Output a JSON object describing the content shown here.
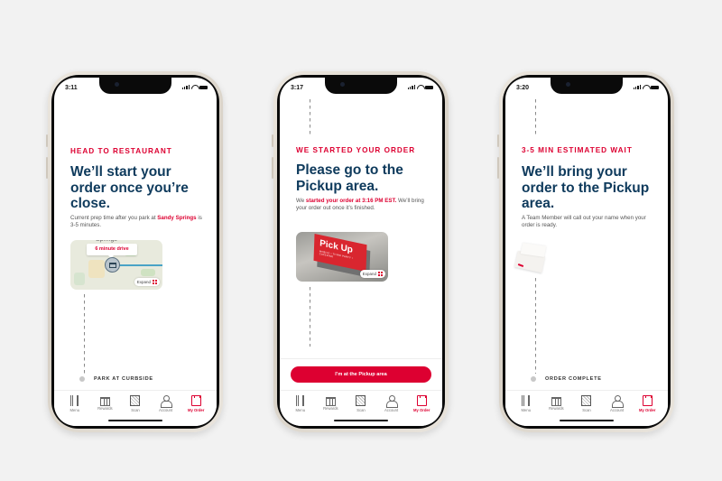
{
  "brand_colors": {
    "accent": "#dd0031",
    "headline": "#0e3a5c",
    "background": "#f2f2f2"
  },
  "tabbar": [
    {
      "label": "Menu",
      "icon": "fork-knife-icon"
    },
    {
      "label": "Rewards",
      "icon": "gift-icon"
    },
    {
      "label": "Scan",
      "icon": "qr-code-icon"
    },
    {
      "label": "Account",
      "icon": "person-icon"
    },
    {
      "label": "My Order",
      "icon": "bag-icon",
      "active": true
    }
  ],
  "phones": [
    {
      "status_time": "3:11",
      "eyebrow": "HEAD TO RESTAURANT",
      "headline": "We’ll start your order once you’re close.",
      "body_prefix": "Current prep time after you park at ",
      "body_highlight": "Sandy Springs",
      "body_suffix": " is 3-5 minutes.",
      "map": {
        "city_label": "Springs",
        "drive_time": "6 minute drive",
        "expand_label": "Expand"
      },
      "next_step": "PARK AT CURBSIDE"
    },
    {
      "status_time": "3:17",
      "eyebrow": "WE STARTED YOUR ORDER",
      "headline": "Please go to the Pickup area.",
      "body_prefix": "We ",
      "body_highlight": "started your order at 3:16 PM EST.",
      "body_suffix": " We’ll bring your order out once it’s finished.",
      "photo": {
        "sign_title": "Pick Up",
        "sign_subtitle": "MOBILE • THIRD PARTY • CATERING",
        "expand_label": "Expand"
      },
      "cta_label": "I’m at the Pickup area"
    },
    {
      "status_time": "3:20",
      "eyebrow": "3-5 MIN ESTIMATED WAIT",
      "headline": "We’ll bring your order to the Pickup area.",
      "body": "A Team Member will call out your name when your order is ready.",
      "next_step": "ORDER COMPLETE"
    }
  ]
}
